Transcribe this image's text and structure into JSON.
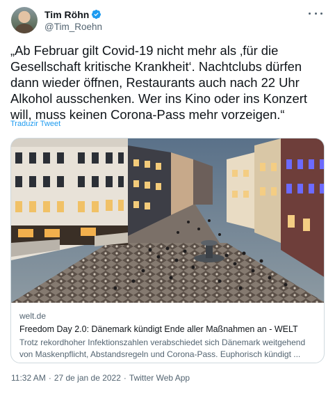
{
  "author": {
    "display_name": "Tim Röhn",
    "handle": "@Tim_Roehn",
    "verified": true
  },
  "tweet": {
    "text": "„Ab Februar gilt Covid-19 nicht mehr als ‚für die Gesellschaft kritische Krankheit‘. Nachtclubs dürfen dann wieder öffnen, Restaurants auch nach 22 Uhr Alkohol ausschenken. Wer ins Kino oder ins Konzert will, muss keinen Corona-Pass mehr vorzeigen.“",
    "translate_label": "Traduzir Tweet"
  },
  "link_card": {
    "domain": "welt.de",
    "title": "Freedom Day 2.0: Dänemark kündigt Ende aller Maßnahmen an - WELT",
    "description": "Trotz rekordhoher Infektionszahlen verabschiedet sich Dänemark weitgehend von Maskenpflicht, Abstandsregeln und Corona-Pass. Euphorisch kündigt ..."
  },
  "footer": {
    "time": "11:32 AM",
    "separator1": "·",
    "date": "27 de jan de 2022",
    "separator2": "·",
    "source": "Twitter Web App"
  },
  "colors": {
    "accent": "#1d9bf0",
    "secondary_text": "#536471",
    "border": "#cfd9de"
  },
  "icons": {
    "verified": "verified-badge-icon",
    "more": "more-horizontal-icon"
  }
}
